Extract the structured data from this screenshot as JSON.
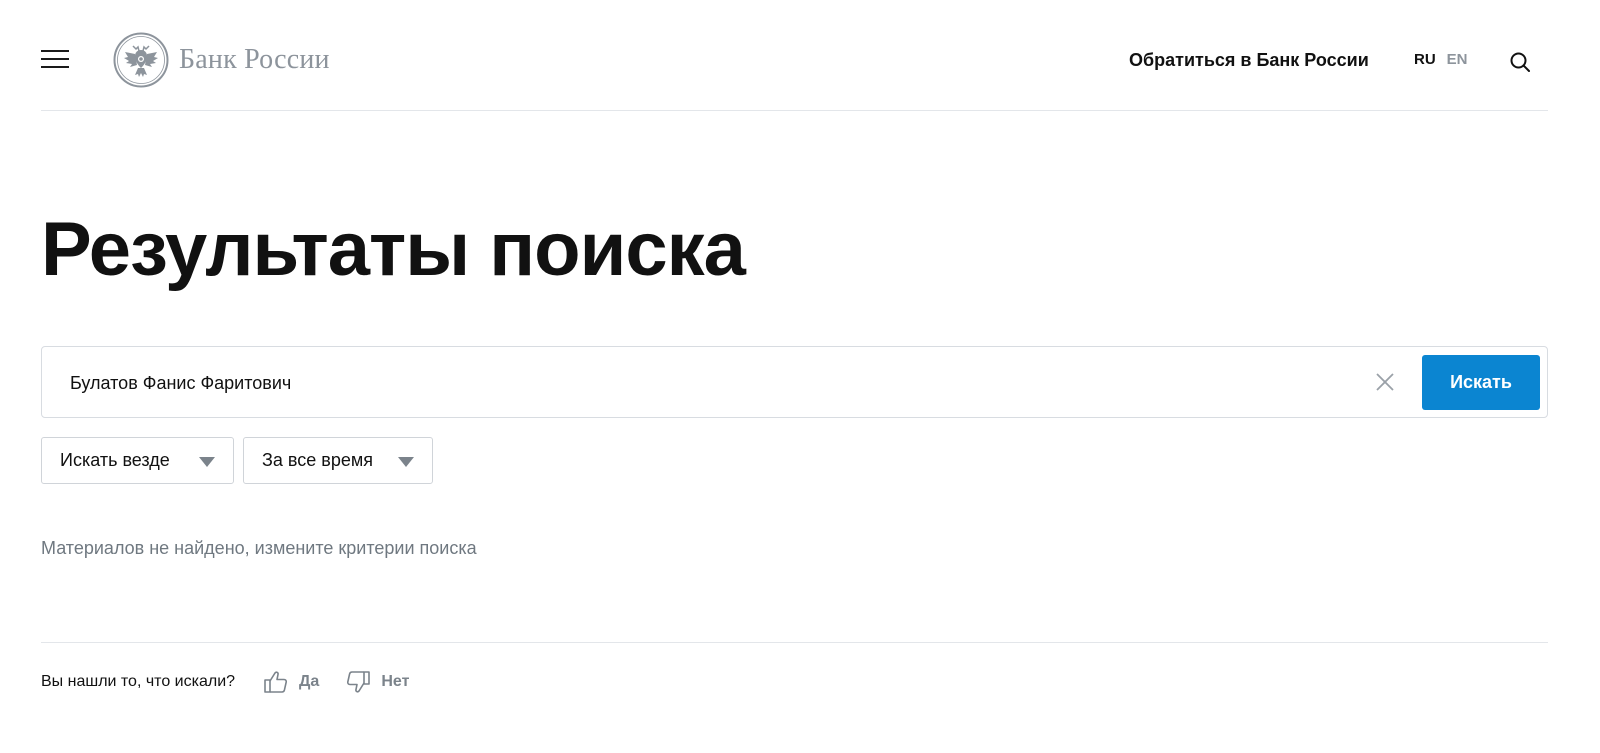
{
  "header": {
    "logo_text": "Банк России",
    "contact_link": "Обратиться в Банк России",
    "lang_ru": "RU",
    "lang_en": "EN"
  },
  "main": {
    "title": "Результаты поиска",
    "search": {
      "value": "Булатов Фанис Фаритович",
      "submit_label": "Искать"
    },
    "filters": {
      "where": "Искать везде",
      "when": "За все время"
    },
    "no_results": "Материалов не найдено, измените критерии поиска"
  },
  "feedback": {
    "question": "Вы нашли то, что искали?",
    "yes": "Да",
    "no": "Нет"
  },
  "colors": {
    "accent": "#0b85d1",
    "muted": "#8d949c"
  },
  "icons": [
    "menu-icon",
    "bank-emblem-icon",
    "search-icon",
    "close-icon",
    "chevron-down-icon",
    "thumbs-up-icon",
    "thumbs-down-icon"
  ]
}
